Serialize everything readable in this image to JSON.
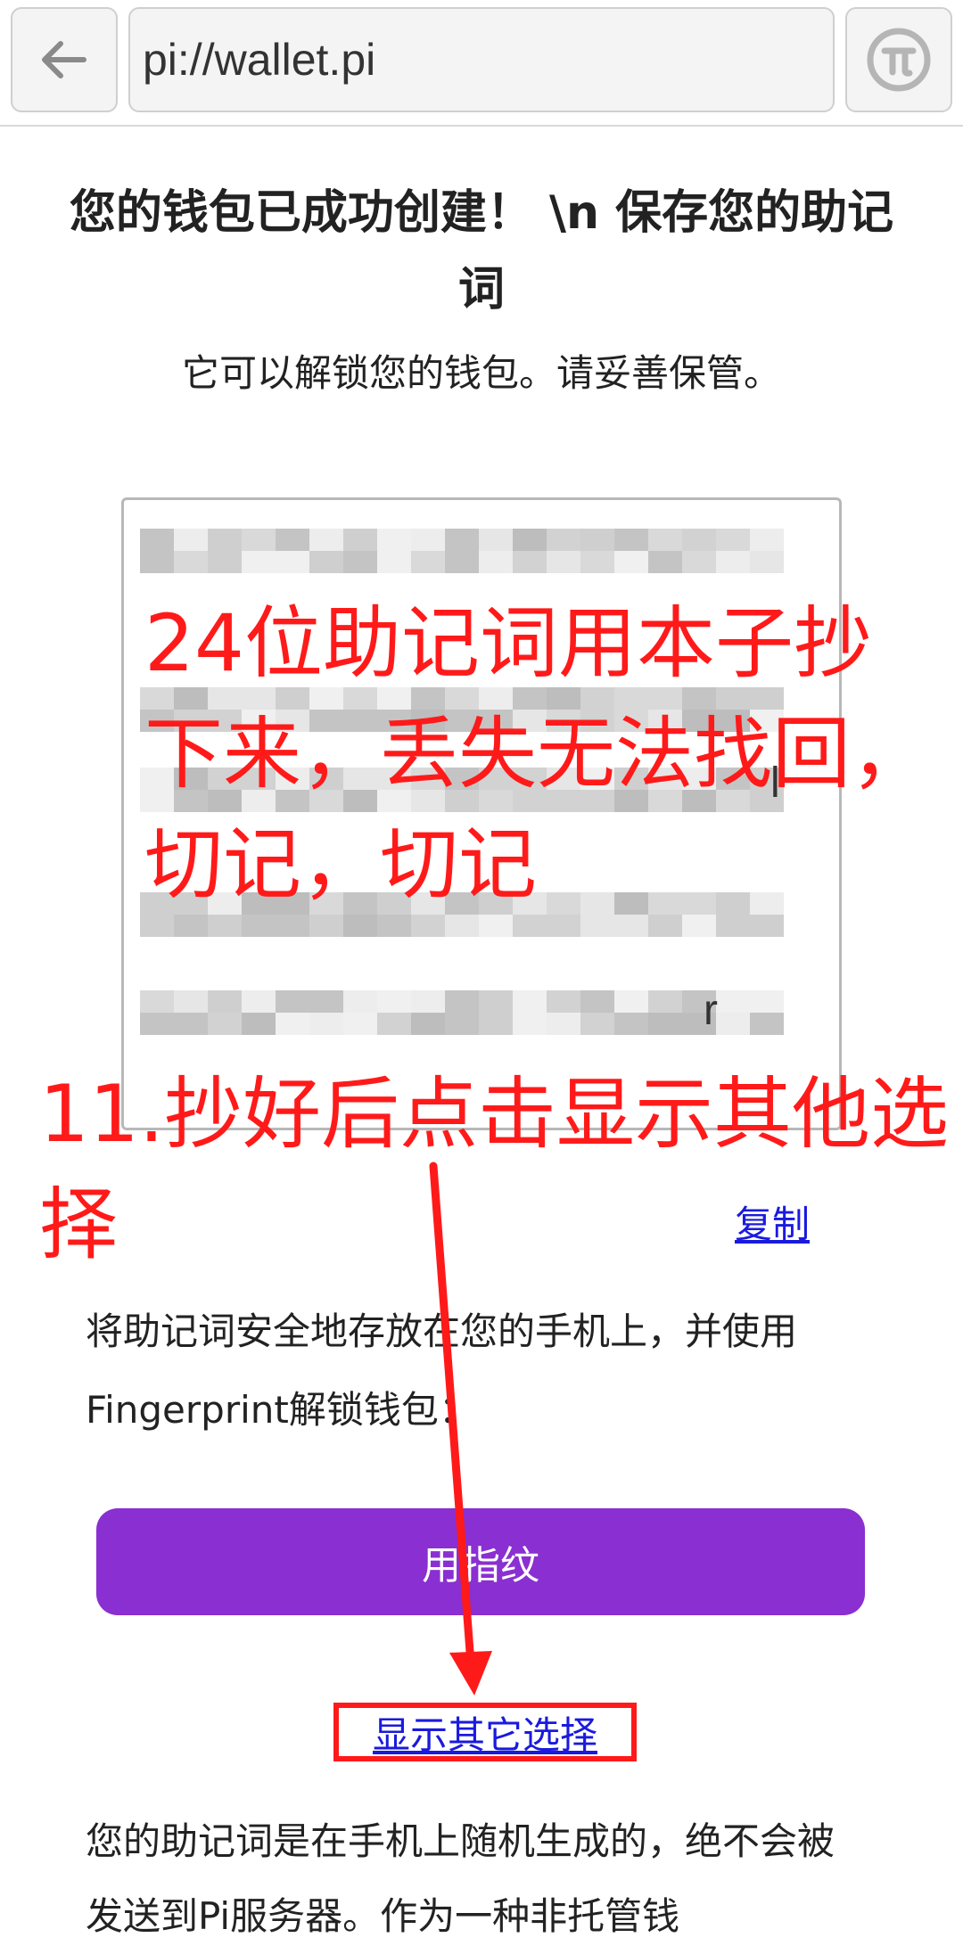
{
  "browser": {
    "url": "pi://wallet.pi",
    "back_icon": "arrow-left-icon",
    "pi_icon": "pi-logo-icon"
  },
  "page": {
    "title": "您的钱包已成功创建！ \\n 保存您的助记词",
    "subtitle": "它可以解锁您的钱包。请妥善保管。",
    "mnemonic_stray_chars": [
      "l",
      "r"
    ],
    "copy_label": "复制",
    "description": "将助记词安全地存放在您的手机上，并使用Fingerprint解锁钱包：",
    "fingerprint_button": "用指纹",
    "more_options_link": "显示其它选择",
    "bottom_text": "您的助记词是在手机上随机生成的，绝不会被发送到Pi服务器。作为一种非托管钱"
  },
  "annotations": {
    "note_1": "24位助记词用本子抄下来，丢失无法找回，切记，切记",
    "note_2": "11.抄好后点击显示其他选择",
    "color": "#ff1a1a"
  },
  "colors": {
    "accent_button": "#8a2fd1",
    "link": "#1a1adf",
    "annotation_red": "#ff1a1a"
  }
}
